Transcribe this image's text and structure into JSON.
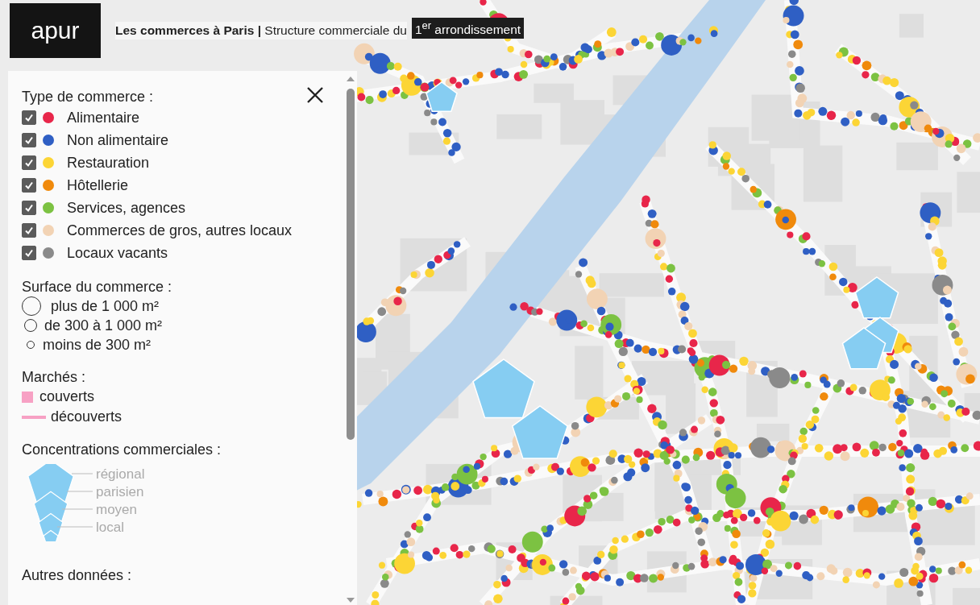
{
  "header": {
    "logo": "apur",
    "title": "**Les commerces à Paris |** Structure commerciale du",
    "badge": "1$^{er}$ arrondissement"
  },
  "legend": {
    "type_section": {
      "title": "Type de commerce :",
      "items": [
        {
          "label": "Alimentaire",
          "checked": true,
          "color": "#e8264a"
        },
        {
          "label": "Non alimentaire",
          "checked": true,
          "color": "#2f5fc4"
        },
        {
          "label": "Restauration",
          "checked": true,
          "color": "#fcd535"
        },
        {
          "label": "Hôtellerie",
          "checked": true,
          "color": "#f08a0c"
        },
        {
          "label": "Services, agences",
          "checked": true,
          "color": "#7cc242"
        },
        {
          "label": "Commerces de gros, autres locaux",
          "checked": true,
          "color": "#f2d3b4"
        },
        {
          "label": "Locaux vacants",
          "checked": true,
          "color": "#8a8a8a"
        }
      ]
    },
    "surface_section": {
      "title": "Surface du commerce :",
      "items": [
        {
          "label": "plus de 1 000 m²",
          "kind": "large"
        },
        {
          "label": "de 300 à 1 000 m²",
          "kind": "medium"
        },
        {
          "label": "moins de 300 m²",
          "kind": "small"
        }
      ]
    },
    "markets_section": {
      "title": "Marchés :",
      "items": [
        {
          "label": "couverts",
          "kind": "square"
        },
        {
          "label": "découverts",
          "kind": "line"
        }
      ]
    },
    "concentration_section": {
      "title": "Concentrations commerciales :",
      "labels": [
        "régional",
        "parisien",
        "moyen",
        "local"
      ]
    },
    "other_section": {
      "title": "Autres données :"
    }
  }
}
